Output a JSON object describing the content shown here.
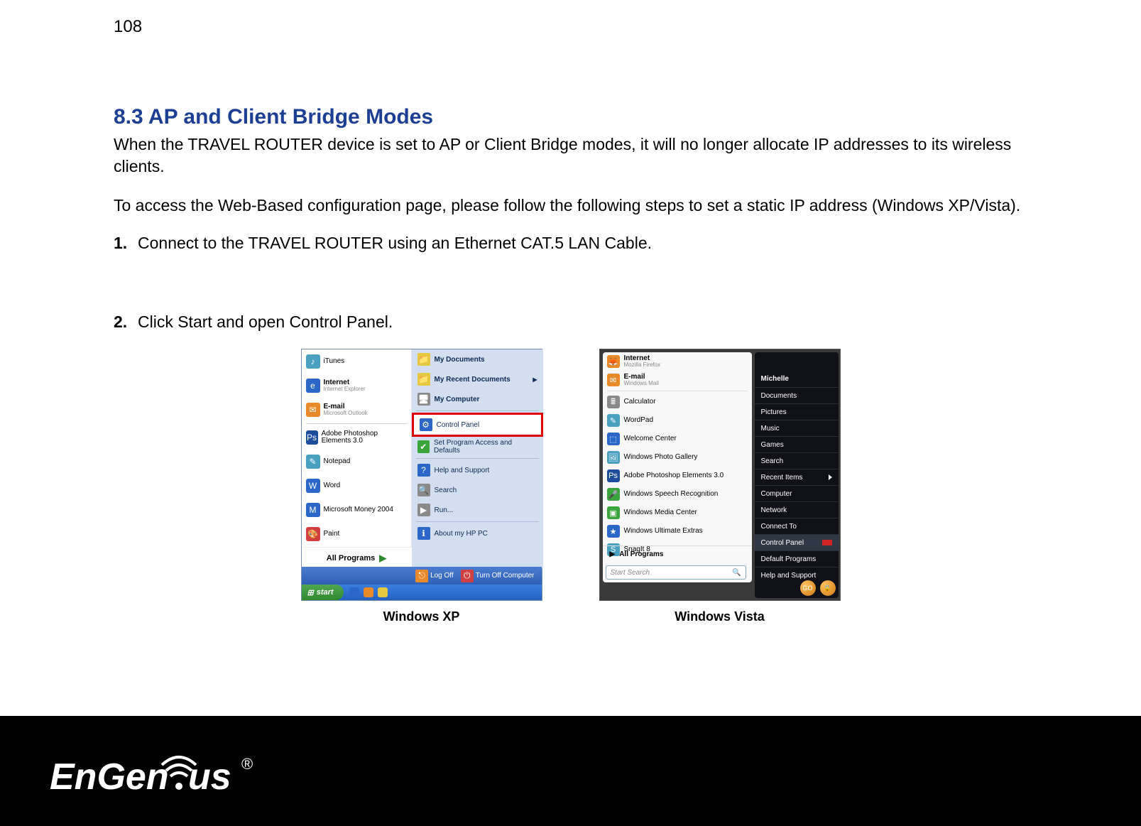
{
  "page_number": "108",
  "section_title": "8.3   AP and Client Bridge Modes",
  "para1": "When the TRAVEL ROUTER device is set to AP or Client Bridge modes, it will no longer allocate IP addresses to its wireless clients.",
  "para2": "To access the Web-Based configuration page, please follow the following steps to set a static IP address (Windows XP/Vista).",
  "step1_num": "1.",
  "step1_txt": "Connect to the TRAVEL ROUTER using an Ethernet CAT.5 LAN Cable.",
  "step2_num": "2.",
  "step2_txt": "Click Start and open Control Panel.",
  "caption_xp": "Windows XP",
  "caption_vista": "Windows Vista",
  "xp": {
    "left_items": [
      {
        "t": "iTunes",
        "s": ""
      },
      {
        "t": "Internet",
        "s": "Internet Explorer"
      },
      {
        "t": "E-mail",
        "s": "Microsoft Outlook"
      },
      {
        "t": "Adobe Photoshop Elements 3.0",
        "s": ""
      },
      {
        "t": "Notepad",
        "s": ""
      },
      {
        "t": "Word",
        "s": ""
      },
      {
        "t": "Microsoft Money 2004",
        "s": ""
      },
      {
        "t": "Paint",
        "s": ""
      }
    ],
    "all_programs": "All Programs",
    "right_items_top": [
      "My Documents",
      "My Recent Documents",
      "My Computer"
    ],
    "control_panel": "Control Panel",
    "right_items_mid": [
      "Set Program Access and Defaults",
      "Help and Support",
      "Search",
      "Run..."
    ],
    "right_items_bot": [
      "About my HP PC"
    ],
    "logoff": "Log Off",
    "shutdown": "Turn Off Computer",
    "start": "start"
  },
  "vista": {
    "left_items": [
      {
        "t": "Internet",
        "s": "Mozilla Firefox"
      },
      {
        "t": "E-mail",
        "s": "Windows Mail"
      },
      {
        "t": "Calculator",
        "s": ""
      },
      {
        "t": "WordPad",
        "s": ""
      },
      {
        "t": "Welcome Center",
        "s": ""
      },
      {
        "t": "Windows Photo Gallery",
        "s": ""
      },
      {
        "t": "Adobe Photoshop Elements 3.0",
        "s": ""
      },
      {
        "t": "Windows Speech Recognition",
        "s": ""
      },
      {
        "t": "Windows Media Center",
        "s": ""
      },
      {
        "t": "Windows Ultimate Extras",
        "s": ""
      },
      {
        "t": "SnagIt 8",
        "s": ""
      }
    ],
    "all_programs": "All Programs",
    "search": "Start Search",
    "right_user": "Michelle",
    "right_items": [
      "Documents",
      "Pictures",
      "Music",
      "Games",
      "Search",
      "Recent Items",
      "Computer",
      "Network",
      "Connect To",
      "Control Panel",
      "Default Programs",
      "Help and Support"
    ],
    "orb1": "GO",
    "orb2": ""
  },
  "brand_text": "EnGenius",
  "brand_reg": "®"
}
